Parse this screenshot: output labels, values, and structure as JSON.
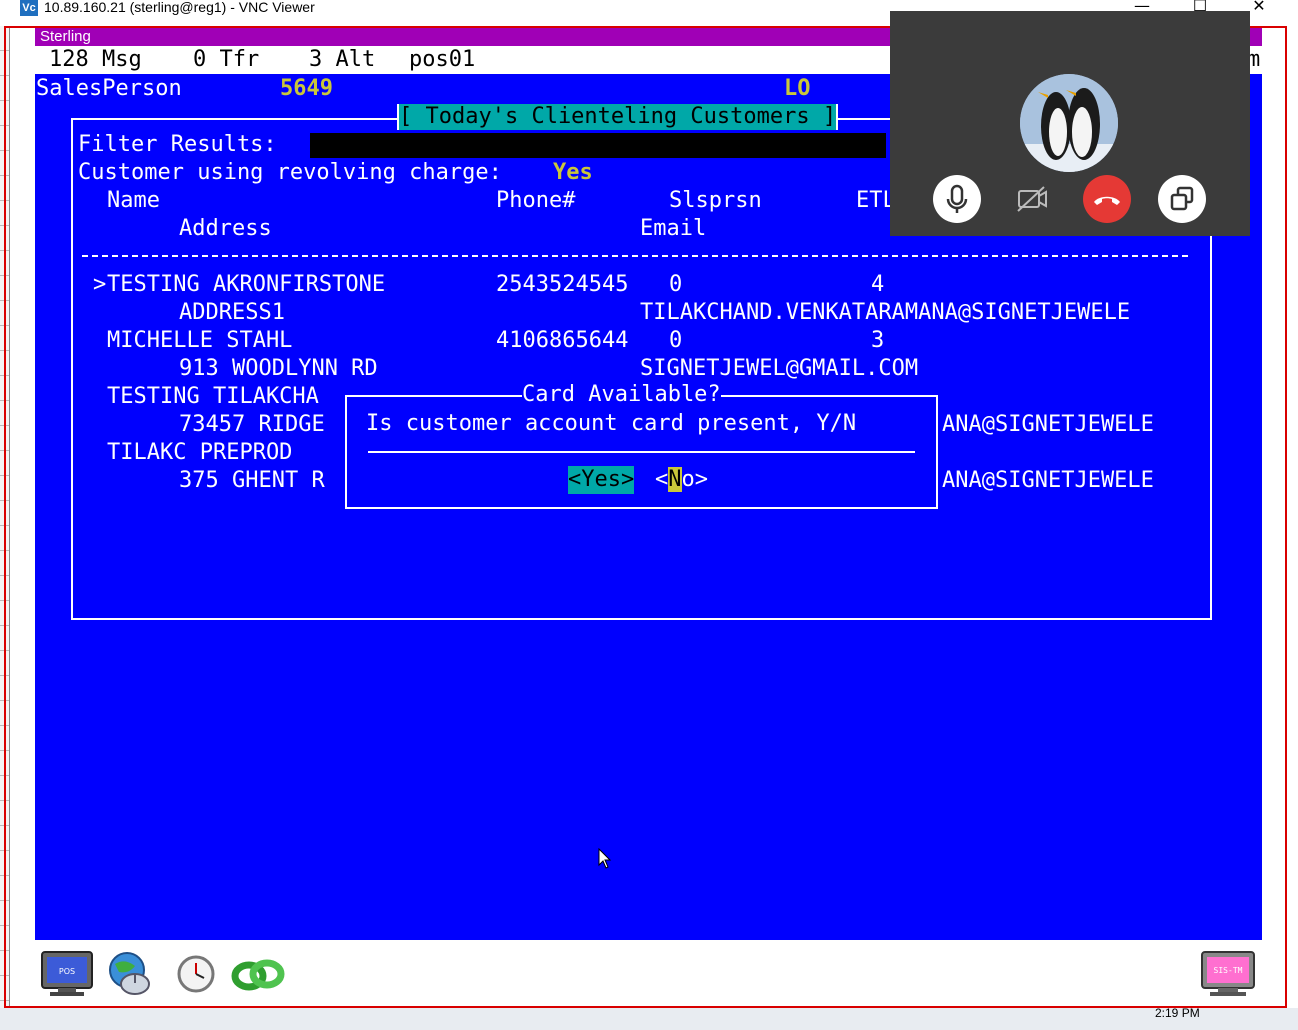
{
  "window": {
    "title": "10.89.160.21 (sterling@reg1) - VNC Viewer",
    "app_icon": "Vc",
    "minimize": "—",
    "maximize": "☐",
    "close": "✕"
  },
  "terminal": {
    "title": "Sterling",
    "status": {
      "msg": "128 Msg",
      "tfr": "0 Tfr",
      "alt": "3 Alt",
      "pos": "pos01",
      "right_fragment": "m"
    },
    "salesperson_label": "SalesPerson",
    "salesperson_id": "5649",
    "lo": "LO",
    "box_title": "[ Today's Clienteling Customers ]",
    "filter_label": "Filter Results:",
    "revolving_label": "Customer using revolving charge:",
    "revolving_value": "Yes",
    "headers": {
      "name": "Name",
      "phone": "Phone#",
      "slsprsn": "Slsprsn",
      "etl": "ETL",
      "address": "Address",
      "email": "Email"
    },
    "separator": "----------------------------------------------------------------------------------------------------------------",
    "rows": [
      {
        "marker": ">",
        "name": "TESTING AKRONFIRSTONE",
        "phone": "2543524545",
        "slsprsn": "0",
        "etl": "4",
        "address": "ADDRESS1",
        "email": "TILAKCHAND.VENKATARAMANA@SIGNETJEWELE"
      },
      {
        "marker": "",
        "name": "MICHELLE STAHL",
        "phone": "4106865644",
        "slsprsn": "0",
        "etl": "3",
        "address": "913 WOODLYNN RD",
        "email": "SIGNETJEWEL@GMAIL.COM"
      },
      {
        "marker": "",
        "name": "TESTING TILAKCHA",
        "phone": "",
        "slsprsn": "",
        "etl": "",
        "address": "73457 RIDGE",
        "email": "ANA@SIGNETJEWELE"
      },
      {
        "marker": "",
        "name": "TILAKC PREPROD",
        "phone": "",
        "slsprsn": "",
        "etl": "",
        "address": "375 GHENT R",
        "email": "ANA@SIGNETJEWELE"
      }
    ],
    "dialog": {
      "title": "Card Available?",
      "prompt": "Is customer account card present, Y/N",
      "yes": "<Yes>",
      "no_open": "<",
      "no_cursor": "N",
      "no_rest": "o>"
    }
  },
  "call": {
    "avatar": "penguins-avatar",
    "buttons": [
      "mic-icon",
      "camera-off-icon",
      "hang-up-icon",
      "switch-window-icon"
    ]
  },
  "taskbar": {
    "icons": [
      "pos-terminal-icon",
      "globe-mouse-icon",
      "clock-icon",
      "link-icon",
      "sis-terminal-icon"
    ],
    "pos_label": "POS",
    "sis_label": "SIS-TM",
    "clock": "2:19 PM"
  },
  "colors": {
    "terminal_bg": "#0000fe",
    "title_bar": "#a000b6",
    "highlight": "#00a8a8",
    "yellow": "#c9c63a",
    "hang_up": "#e53935"
  }
}
